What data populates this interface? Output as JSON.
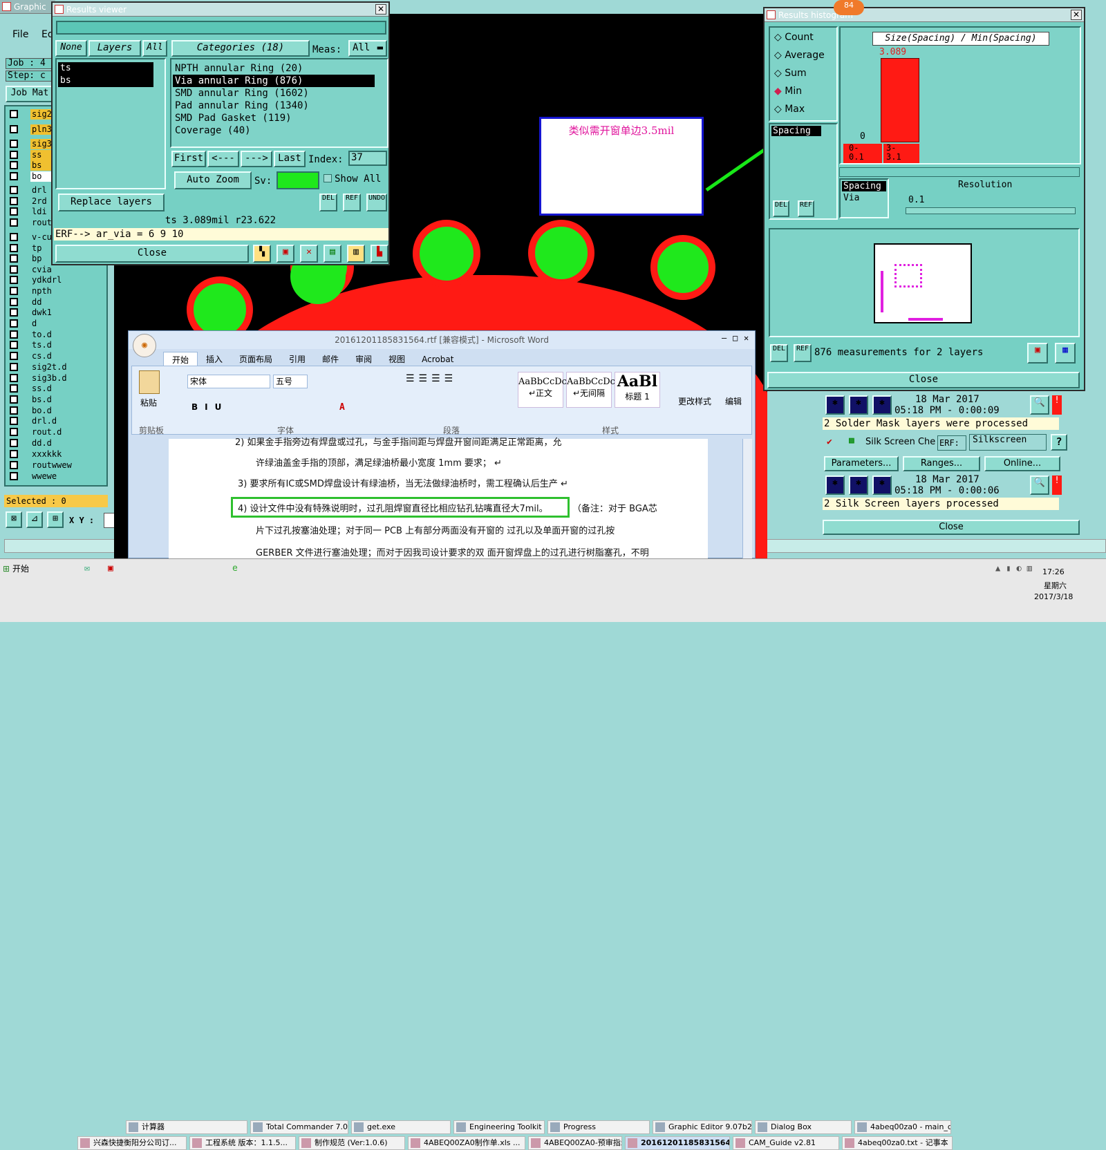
{
  "background_app": {
    "title": "Graphic",
    "menu": [
      "File",
      "Ed"
    ],
    "job_label": "Job : 4",
    "step_label": "Step: c",
    "job_mat": "Job Mat",
    "layers": [
      {
        "name": "sig2",
        "color": "#f0c030"
      },
      {
        "name": "pln3",
        "color": "#f0c030"
      },
      {
        "name": "sig3",
        "color": "#f0c030"
      },
      {
        "name": "ss",
        "color": "#f0c030"
      },
      {
        "name": "bs",
        "color": "#f0c030"
      },
      {
        "name": "bo",
        "color": "#ffffff"
      },
      {
        "name": "drl",
        "color": "#76d0c4"
      },
      {
        "name": "2rd",
        "color": "#76d0c4"
      },
      {
        "name": "ldi",
        "color": "#76d0c4"
      },
      {
        "name": "rout",
        "color": "#76d0c4"
      },
      {
        "name": "v-cu",
        "color": "#76d0c4"
      },
      {
        "name": "tp",
        "color": "#76d0c4"
      },
      {
        "name": "bp",
        "color": "#76d0c4"
      },
      {
        "name": "cvia",
        "color": "#76d0c4"
      },
      {
        "name": "ydkdrl",
        "color": "#76d0c4"
      },
      {
        "name": "npth",
        "color": "#76d0c4"
      },
      {
        "name": "dd",
        "color": "#76d0c4"
      },
      {
        "name": "dwk1",
        "color": "#76d0c4"
      },
      {
        "name": "d",
        "color": "#76d0c4"
      },
      {
        "name": "to.d",
        "color": "#76d0c4"
      },
      {
        "name": "ts.d",
        "color": "#76d0c4"
      },
      {
        "name": "cs.d",
        "color": "#76d0c4"
      },
      {
        "name": "sig2t.d",
        "color": "#76d0c4"
      },
      {
        "name": "sig3b.d",
        "color": "#76d0c4"
      },
      {
        "name": "ss.d",
        "color": "#76d0c4"
      },
      {
        "name": "bs.d",
        "color": "#76d0c4"
      },
      {
        "name": "bo.d",
        "color": "#76d0c4"
      },
      {
        "name": "drl.d",
        "color": "#76d0c4"
      },
      {
        "name": "rout.d",
        "color": "#76d0c4"
      },
      {
        "name": "dd.d",
        "color": "#76d0c4"
      },
      {
        "name": "xxxkkk",
        "color": "#76d0c4"
      },
      {
        "name": "routwwew",
        "color": "#76d0c4"
      },
      {
        "name": "wwewe",
        "color": "#76d0c4"
      }
    ],
    "selected": "Selected : 0",
    "xy_label": "X Y :"
  },
  "results_viewer": {
    "title": "Results viewer",
    "none_label": "None",
    "layers_label": "Layers",
    "all_label": "All",
    "categories_label": "Categories (18)",
    "meas_label": "Meas:",
    "meas_value": "All",
    "layer_items": [
      "ts",
      "bs"
    ],
    "categories": [
      "NPTH annular Ring (20)",
      "Via annular Ring (876)",
      "SMD annular Ring (1602)",
      "Pad annular Ring (1340)",
      "SMD Pad Gasket (119)",
      "Coverage (40)"
    ],
    "first": "First",
    "prev": "<---",
    "next": "--->",
    "last": "Last",
    "index_label": "Index:",
    "index_value": "37",
    "auto_zoom": "Auto Zoom",
    "sv_label": "Sv:",
    "show_all": "Show All",
    "replace_layers": "Replace layers",
    "del": "DEL",
    "ref": "REF",
    "undo": "UNDO",
    "status": "ts 3.089mil   r23.622",
    "erf": "ERF--> ar_via = 6 9 10",
    "close": "Close"
  },
  "annotation": {
    "text": "类似需开窗单边3.5mil"
  },
  "histogram": {
    "title": "Results histogram",
    "badge": "84",
    "radio_count": "Count",
    "radio_average": "Average",
    "radio_sum": "Sum",
    "radio_min": "Min",
    "radio_max": "Max",
    "selected_radio": "Min",
    "spacing_item": "Spacing",
    "chart_title": "Size(Spacing) / Min(Spacing)",
    "bar_value": "3.089",
    "zero_label": "0",
    "bin1": "0-\n0.1",
    "bin2": "3-\n3.1",
    "spacing_label": "Spacing",
    "via_label": "Via",
    "resolution_label": "Resolution",
    "resolution_value": "0.1",
    "measurements": "876 measurements for 2 layers",
    "close": "Close",
    "del": "DEL",
    "ref": "REF"
  },
  "checks": {
    "date1": "18 Mar 2017",
    "time1": "05:18 PM - 0:00:09",
    "msg1": "2 Solder Mask layers were processed",
    "silk_check": "Silk Screen Che",
    "erf_label": "ERF:",
    "erf_value": "Silkscreen",
    "help": "?",
    "params": "Parameters...",
    "ranges": "Ranges...",
    "online": "Online...",
    "date2": "18 Mar 2017",
    "time2": "05:18 PM - 0:00:06",
    "msg2": "2 Silk Screen layers processed",
    "close": "Close"
  },
  "word": {
    "title": "20161201185831564.rtf [兼容模式] - Microsoft Word",
    "tabs": [
      "开始",
      "插入",
      "页面布局",
      "引用",
      "邮件",
      "审阅",
      "视图",
      "Acrobat"
    ],
    "font_name": "宋体",
    "font_size": "五号",
    "paste": "粘贴",
    "clipboard": "剪贴板",
    "font_group": "字体",
    "para_group": "段落",
    "styles_group": "样式",
    "edit_group": "编辑",
    "change_styles": "更改样式",
    "style1_sample": "AaBbCcDc",
    "style1": "↵正文",
    "style2_sample": "AaBbCcDc",
    "style2": "↵无间隔",
    "style3_sample": "AaBl",
    "style3": "标题 1",
    "doc_lines": [
      "2)   如果金手指旁边有焊盘或过孔，与金手指间距与焊盘开窗间距满足正常距离，允",
      "许绿油盖金手指的顶部，满足绿油桥最小宽度 1mm 要求； ↵",
      "3)   要求所有IC或SMD焊盘设计有绿油桥，当无法做绿油桥时，需工程确认后生产 ↵",
      "4)   设计文件中没有特殊说明时，过孔阻焊窗直径比相应钻孔钻嘴直径大7mil。",
      "（备注：对于 BGA芯",
      "片下过孔按塞油处理；对于同一 PCB 上有部分两面没有开窗的 过孔以及单面开窗的过孔按",
      "GERBER 文件进行塞油处理；而对于因我司设计要求的双 面开窗焊盘上的过孔进行树脂塞孔，不明"
    ]
  },
  "taskbar": {
    "start": "开始",
    "row1": [
      "计算器",
      "Total Commander 7.0 ...",
      "get.exe",
      "Engineering Toolkit 9....",
      "Progress",
      "Graphic Editor 9.07b2 ...",
      "Dialog Box",
      "4abeq00za0 - main_qa"
    ],
    "row2": [
      "兴森快捷衡阳分公司订...",
      "工程系统  版本：1.1.5...",
      "制作规范 (Ver:1.0.6)",
      "4ABEQ00ZA0制作单.xls ...",
      "4ABEQ00ZA0-预审指示....",
      "20161201185831564....",
      "CAM_Guide v2.81",
      "4abeq00za0.txt - 记事本"
    ],
    "clock": "17:26",
    "weekday": "星期六",
    "date": "2017/3/18"
  }
}
